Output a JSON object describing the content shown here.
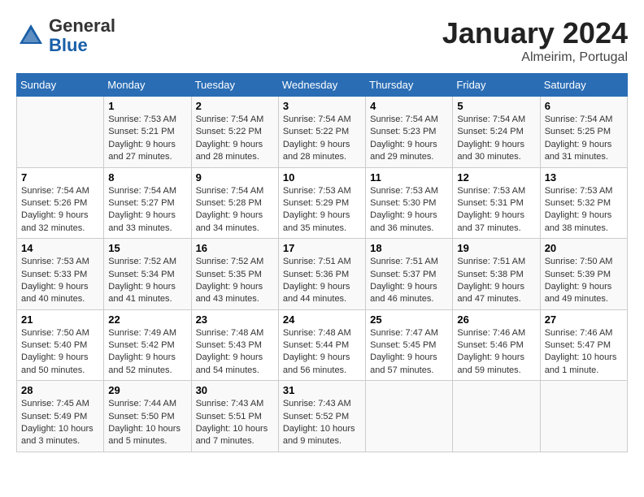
{
  "header": {
    "logo_line1": "General",
    "logo_line2": "Blue",
    "month": "January 2024",
    "location": "Almeirim, Portugal"
  },
  "weekdays": [
    "Sunday",
    "Monday",
    "Tuesday",
    "Wednesday",
    "Thursday",
    "Friday",
    "Saturday"
  ],
  "weeks": [
    [
      {
        "day": "",
        "info": ""
      },
      {
        "day": "1",
        "info": "Sunrise: 7:53 AM\nSunset: 5:21 PM\nDaylight: 9 hours\nand 27 minutes."
      },
      {
        "day": "2",
        "info": "Sunrise: 7:54 AM\nSunset: 5:22 PM\nDaylight: 9 hours\nand 28 minutes."
      },
      {
        "day": "3",
        "info": "Sunrise: 7:54 AM\nSunset: 5:22 PM\nDaylight: 9 hours\nand 28 minutes."
      },
      {
        "day": "4",
        "info": "Sunrise: 7:54 AM\nSunset: 5:23 PM\nDaylight: 9 hours\nand 29 minutes."
      },
      {
        "day": "5",
        "info": "Sunrise: 7:54 AM\nSunset: 5:24 PM\nDaylight: 9 hours\nand 30 minutes."
      },
      {
        "day": "6",
        "info": "Sunrise: 7:54 AM\nSunset: 5:25 PM\nDaylight: 9 hours\nand 31 minutes."
      }
    ],
    [
      {
        "day": "7",
        "info": "Sunrise: 7:54 AM\nSunset: 5:26 PM\nDaylight: 9 hours\nand 32 minutes."
      },
      {
        "day": "8",
        "info": "Sunrise: 7:54 AM\nSunset: 5:27 PM\nDaylight: 9 hours\nand 33 minutes."
      },
      {
        "day": "9",
        "info": "Sunrise: 7:54 AM\nSunset: 5:28 PM\nDaylight: 9 hours\nand 34 minutes."
      },
      {
        "day": "10",
        "info": "Sunrise: 7:53 AM\nSunset: 5:29 PM\nDaylight: 9 hours\nand 35 minutes."
      },
      {
        "day": "11",
        "info": "Sunrise: 7:53 AM\nSunset: 5:30 PM\nDaylight: 9 hours\nand 36 minutes."
      },
      {
        "day": "12",
        "info": "Sunrise: 7:53 AM\nSunset: 5:31 PM\nDaylight: 9 hours\nand 37 minutes."
      },
      {
        "day": "13",
        "info": "Sunrise: 7:53 AM\nSunset: 5:32 PM\nDaylight: 9 hours\nand 38 minutes."
      }
    ],
    [
      {
        "day": "14",
        "info": "Sunrise: 7:53 AM\nSunset: 5:33 PM\nDaylight: 9 hours\nand 40 minutes."
      },
      {
        "day": "15",
        "info": "Sunrise: 7:52 AM\nSunset: 5:34 PM\nDaylight: 9 hours\nand 41 minutes."
      },
      {
        "day": "16",
        "info": "Sunrise: 7:52 AM\nSunset: 5:35 PM\nDaylight: 9 hours\nand 43 minutes."
      },
      {
        "day": "17",
        "info": "Sunrise: 7:51 AM\nSunset: 5:36 PM\nDaylight: 9 hours\nand 44 minutes."
      },
      {
        "day": "18",
        "info": "Sunrise: 7:51 AM\nSunset: 5:37 PM\nDaylight: 9 hours\nand 46 minutes."
      },
      {
        "day": "19",
        "info": "Sunrise: 7:51 AM\nSunset: 5:38 PM\nDaylight: 9 hours\nand 47 minutes."
      },
      {
        "day": "20",
        "info": "Sunrise: 7:50 AM\nSunset: 5:39 PM\nDaylight: 9 hours\nand 49 minutes."
      }
    ],
    [
      {
        "day": "21",
        "info": "Sunrise: 7:50 AM\nSunset: 5:40 PM\nDaylight: 9 hours\nand 50 minutes."
      },
      {
        "day": "22",
        "info": "Sunrise: 7:49 AM\nSunset: 5:42 PM\nDaylight: 9 hours\nand 52 minutes."
      },
      {
        "day": "23",
        "info": "Sunrise: 7:48 AM\nSunset: 5:43 PM\nDaylight: 9 hours\nand 54 minutes."
      },
      {
        "day": "24",
        "info": "Sunrise: 7:48 AM\nSunset: 5:44 PM\nDaylight: 9 hours\nand 56 minutes."
      },
      {
        "day": "25",
        "info": "Sunrise: 7:47 AM\nSunset: 5:45 PM\nDaylight: 9 hours\nand 57 minutes."
      },
      {
        "day": "26",
        "info": "Sunrise: 7:46 AM\nSunset: 5:46 PM\nDaylight: 9 hours\nand 59 minutes."
      },
      {
        "day": "27",
        "info": "Sunrise: 7:46 AM\nSunset: 5:47 PM\nDaylight: 10 hours\nand 1 minute."
      }
    ],
    [
      {
        "day": "28",
        "info": "Sunrise: 7:45 AM\nSunset: 5:49 PM\nDaylight: 10 hours\nand 3 minutes."
      },
      {
        "day": "29",
        "info": "Sunrise: 7:44 AM\nSunset: 5:50 PM\nDaylight: 10 hours\nand 5 minutes."
      },
      {
        "day": "30",
        "info": "Sunrise: 7:43 AM\nSunset: 5:51 PM\nDaylight: 10 hours\nand 7 minutes."
      },
      {
        "day": "31",
        "info": "Sunrise: 7:43 AM\nSunset: 5:52 PM\nDaylight: 10 hours\nand 9 minutes."
      },
      {
        "day": "",
        "info": ""
      },
      {
        "day": "",
        "info": ""
      },
      {
        "day": "",
        "info": ""
      }
    ]
  ]
}
